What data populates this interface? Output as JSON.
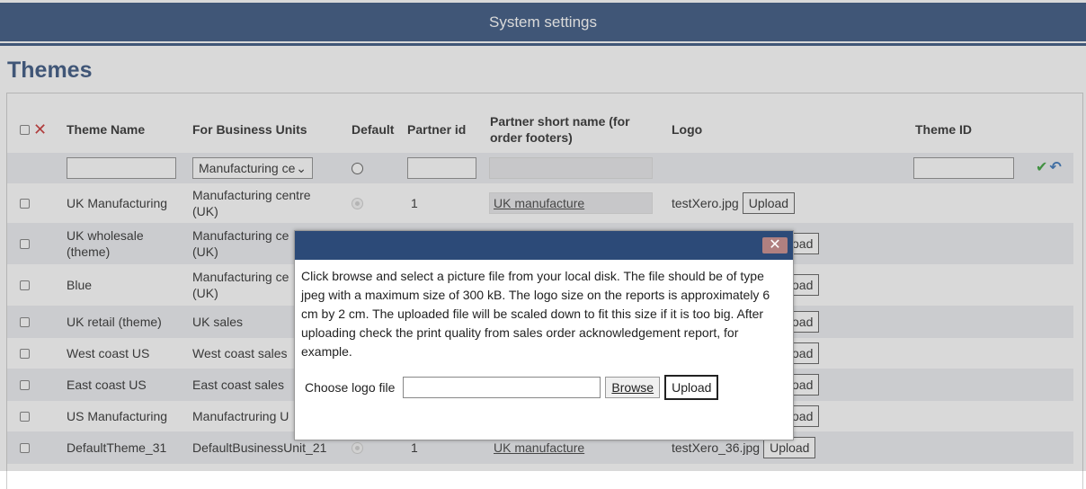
{
  "header": {
    "title": "System settings"
  },
  "page": {
    "title": "Themes"
  },
  "table": {
    "columns": {
      "theme_name": "Theme Name",
      "business_units": "For Business Units",
      "default": "Default",
      "partner_id": "Partner id",
      "short_name_line1": "Partner short name (for",
      "short_name_line2": "order footers)",
      "logo": "Logo",
      "theme_id": "Theme ID"
    },
    "filter": {
      "business_unit_selected": "Manufacturing ce"
    },
    "upload_label": "Upload",
    "rows": [
      {
        "name": "UK Manufacturing",
        "unit1": "Manufacturing centre",
        "unit2": "(UK)",
        "partner_id": "1",
        "short_name": "UK manufacture",
        "logo": "testXero.jpg",
        "upload_stub": "Upload"
      },
      {
        "name": "UK wholesale",
        "name2": "(theme)",
        "unit1": "Manufacturing ce",
        "unit2": "(UK)",
        "upload_stub": "oad"
      },
      {
        "name": "Blue",
        "unit1": "Manufacturing ce",
        "unit2": "(UK)",
        "upload_stub": "oad"
      },
      {
        "name": "UK retail (theme)",
        "unit1": "UK sales",
        "upload_stub": "oad"
      },
      {
        "name": "West coast US",
        "unit1": "West coast sales",
        "upload_stub": "oad"
      },
      {
        "name": "East coast US",
        "unit1": "East coast sales",
        "upload_stub": "oad"
      },
      {
        "name": "US Manufacturing",
        "unit1": "Manufactruring U",
        "upload_stub": "oad"
      },
      {
        "name": "DefaultTheme_31",
        "unit1": "DefaultBusinessUnit_21",
        "partner_id": "1",
        "short_name": "UK manufacture",
        "logo": "testXero_36.jpg",
        "upload_stub": "Upload"
      }
    ]
  },
  "dialog": {
    "message": "Click browse and select a picture file from your local disk. The file should be of type jpeg with a maximum size of 300 kB. The logo size on the reports is approximately 6 cm by 2 cm. The uploaded file will be scaled down to fit this size if it is too big. After uploading check the print quality from sales order acknowledgement report, for example.",
    "file_label": "Choose logo file",
    "browse_label": "Browse",
    "upload_label": "Upload",
    "close_symbol": "✕"
  },
  "icons": {
    "delete": "red-x",
    "save": "green-check",
    "undo": "blue-undo"
  },
  "colors": {
    "header_bg": "#2c4a78",
    "title": "#2c4a78",
    "row_shade": "#eceef1"
  }
}
